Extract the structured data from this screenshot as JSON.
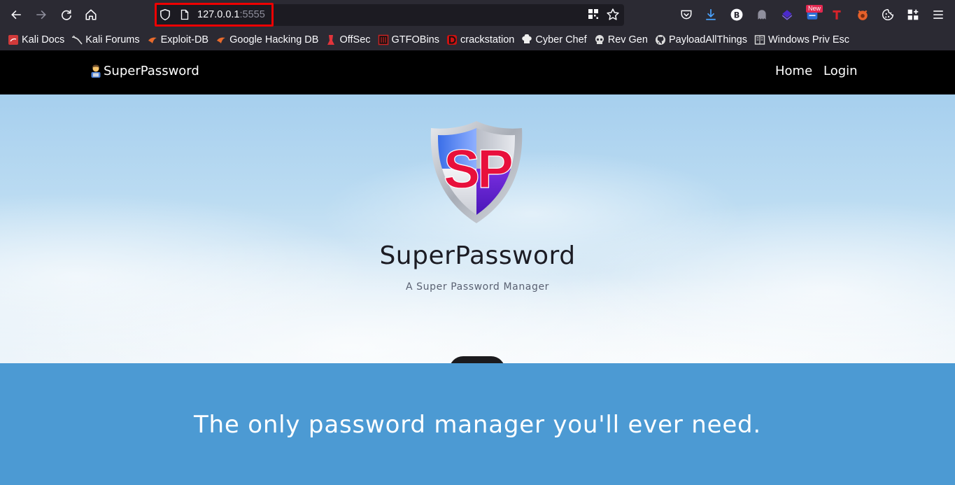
{
  "browser": {
    "url_host": "127.0.0.1",
    "url_port": ":5555",
    "extension_badge": "New",
    "bookmarks": [
      {
        "label": "Kali Docs",
        "icon": "kali-docs-icon",
        "color": "#d13a3a"
      },
      {
        "label": "Kali Forums",
        "icon": "kali-dragon-icon",
        "color": "#dddddd"
      },
      {
        "label": "Exploit-DB",
        "icon": "exploit-db-icon",
        "color": "#e86a2c"
      },
      {
        "label": "Google Hacking DB",
        "icon": "ghdb-icon",
        "color": "#e86a2c"
      },
      {
        "label": "OffSec",
        "icon": "offsec-icon",
        "color": "#e2343b"
      },
      {
        "label": "GTFOBins",
        "icon": "gtfobins-icon",
        "color": "#cc2222"
      },
      {
        "label": "crackstation",
        "icon": "crackstation-icon",
        "color": "#cc1111"
      },
      {
        "label": "Cyber Chef",
        "icon": "cyber-chef-icon",
        "color": "#eeeeee"
      },
      {
        "label": "Rev Gen",
        "icon": "skull-icon",
        "color": "#dddddd"
      },
      {
        "label": "PayloadAllThings",
        "icon": "github-icon",
        "color": "#dddddd"
      },
      {
        "label": "Windows Priv Esc",
        "icon": "book-icon",
        "color": "#dddddd"
      }
    ]
  },
  "site": {
    "brand": "SuperPassword",
    "nav": {
      "home": "Home",
      "login": "Login"
    },
    "hero": {
      "logo_text": "SP",
      "title": "SuperPassword",
      "subtitle": "A Super Password Manager"
    },
    "tagline": "The only password manager you'll ever need."
  },
  "colors": {
    "navbar": "#000000",
    "band": "#4c9ad3",
    "url_highlight": "#e00000"
  }
}
